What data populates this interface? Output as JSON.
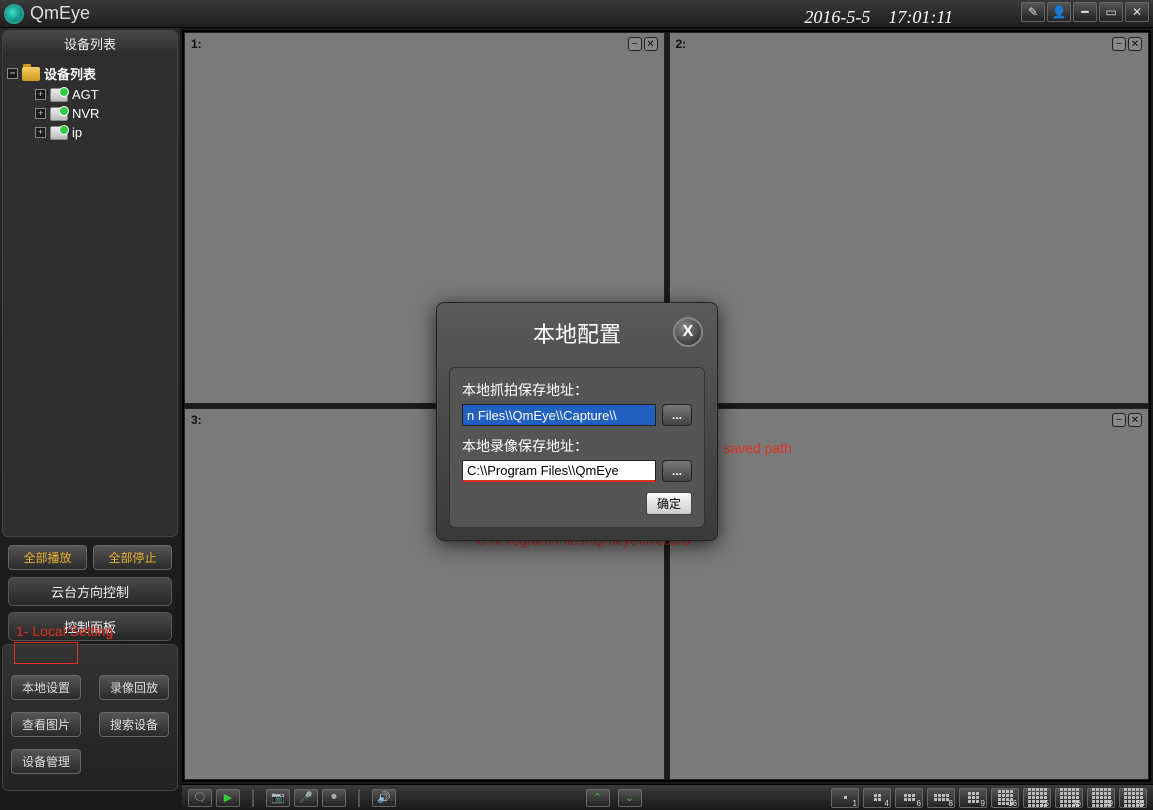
{
  "app": {
    "title": "QmEye"
  },
  "datetime": "2016-5-5　17:01:11",
  "sidebar": {
    "header": "设备列表",
    "root_label": "设备列表",
    "devices": [
      {
        "label": "AGT"
      },
      {
        "label": "NVR"
      },
      {
        "label": "ip"
      }
    ]
  },
  "buttons": {
    "play_all": "全部播放",
    "stop_all": "全部停止",
    "ptz": "云台方向控制",
    "panel": "控制面板",
    "local_setting": "本地设置",
    "playback": "录像回放",
    "view_image": "查看图片",
    "search_device": "搜索设备",
    "device_manage": "设备管理"
  },
  "annotations": {
    "local_setting": "1- Local Setting",
    "record_path_label": "2- Local record saved path",
    "record_path_sample": "C:\\\\Program Files\\\\Qmeye\\\\Record"
  },
  "tiles": [
    {
      "label": "1:"
    },
    {
      "label": "2:"
    },
    {
      "label": "3:"
    },
    {
      "label": ""
    }
  ],
  "layout_buttons": [
    "1",
    "4",
    "6",
    "8",
    "9",
    "16",
    "25",
    "36",
    "49",
    "64"
  ],
  "dialog": {
    "title": "本地配置",
    "capture_label": "本地抓拍保存地址：",
    "capture_value": "n Files\\\\QmEye\\\\Capture\\\\",
    "record_label": "本地录像保存地址：",
    "record_value": "C:\\\\Program Files\\\\QmEye",
    "ok": "确定",
    "browse": "..."
  }
}
